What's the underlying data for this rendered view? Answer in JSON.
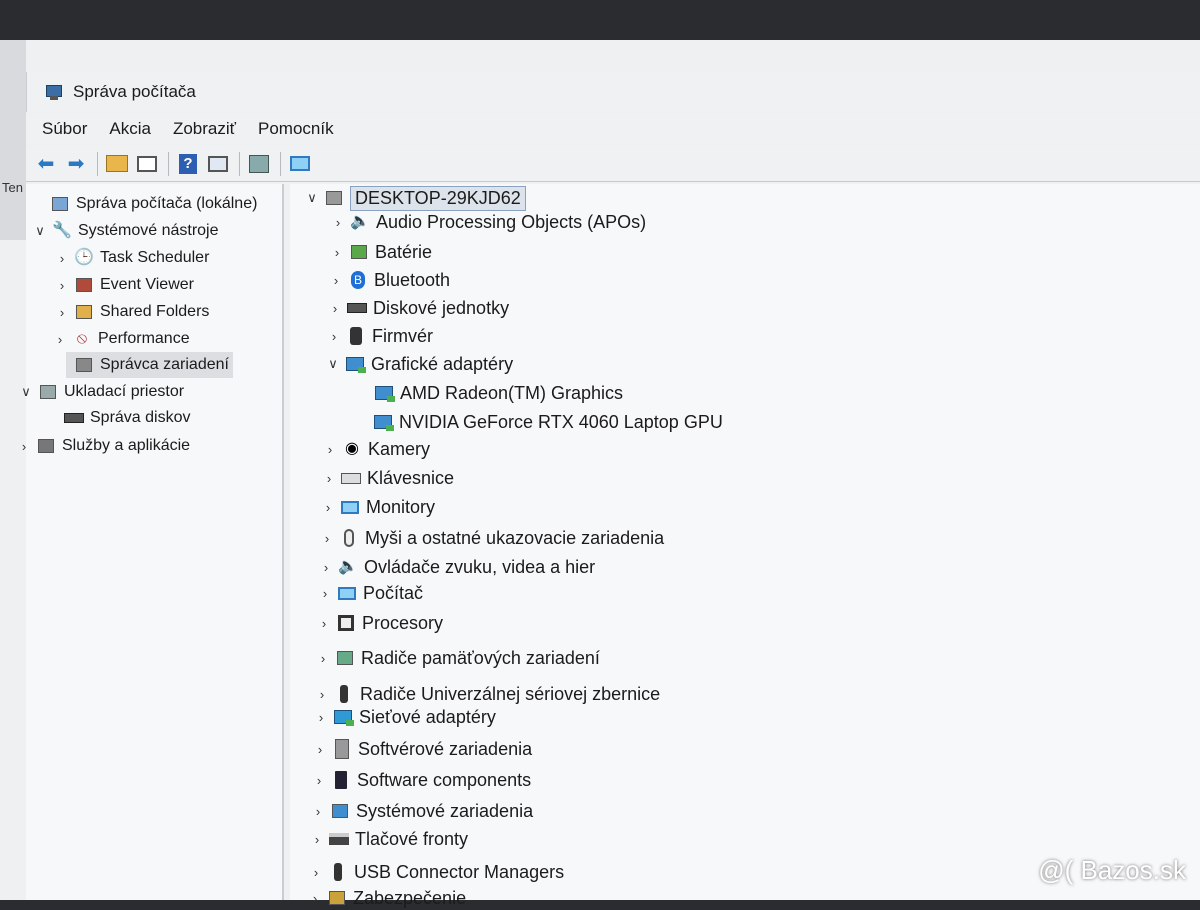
{
  "window": {
    "title": "Správa počítača"
  },
  "desktop": {
    "partial_text": "Ten"
  },
  "menu": [
    "Súbor",
    "Akcia",
    "Zobraziť",
    "Pomocník"
  ],
  "toolbar": {
    "buttons": [
      "back-arrow-icon",
      "forward-arrow-icon",
      "folder-up-icon",
      "properties-icon",
      "help-icon",
      "show-pane-icon",
      "export-icon",
      "monitor-icon"
    ]
  },
  "left_tree": [
    {
      "label": "Správa počítača (lokálne)",
      "icon": "computer-management-icon",
      "expander": ""
    },
    {
      "label": "Systémové nástroje",
      "icon": "tools-icon",
      "expander": "down"
    },
    {
      "label": "Task Scheduler",
      "icon": "clock-icon",
      "expander": "right"
    },
    {
      "label": "Event Viewer",
      "icon": "event-viewer-icon",
      "expander": "right"
    },
    {
      "label": "Shared Folders",
      "icon": "shared-folder-icon",
      "expander": "right"
    },
    {
      "label": "Performance",
      "icon": "performance-icon",
      "expander": "right"
    },
    {
      "label": "Správca zariadení",
      "icon": "device-manager-icon",
      "expander": "",
      "selected": true
    },
    {
      "label": "Ukladací priestor",
      "icon": "storage-icon",
      "expander": "down"
    },
    {
      "label": "Správa diskov",
      "icon": "disk-management-icon",
      "expander": ""
    },
    {
      "label": "Služby a aplikácie",
      "icon": "services-icon",
      "expander": "right"
    }
  ],
  "device_tree": {
    "root": "DESKTOP-29KJD62",
    "items": [
      {
        "label": "Audio Processing Objects (APOs)",
        "icon": "speaker-icon",
        "expander": "right"
      },
      {
        "label": "Batérie",
        "icon": "battery-icon",
        "expander": "right"
      },
      {
        "label": "Bluetooth",
        "icon": "bluetooth-icon",
        "expander": "right"
      },
      {
        "label": "Diskové jednotky",
        "icon": "disk-drive-icon",
        "expander": "right"
      },
      {
        "label": "Firmvér",
        "icon": "firmware-icon",
        "expander": "right"
      },
      {
        "label": "Grafické adaptéry",
        "icon": "display-adapter-icon",
        "expander": "down"
      },
      {
        "label": "AMD Radeon(TM) Graphics",
        "icon": "display-adapter-icon",
        "expander": "",
        "child": true
      },
      {
        "label": "NVIDIA GeForce RTX 4060 Laptop GPU",
        "icon": "display-adapter-icon",
        "expander": "",
        "child": true
      },
      {
        "label": "Kamery",
        "icon": "camera-icon",
        "expander": "right"
      },
      {
        "label": "Klávesnice",
        "icon": "keyboard-icon",
        "expander": "right"
      },
      {
        "label": "Monitory",
        "icon": "monitor-icon",
        "expander": "right"
      },
      {
        "label": "Myši a ostatné ukazovacie zariadenia",
        "icon": "mouse-icon",
        "expander": "right"
      },
      {
        "label": "Ovládače zvuku, videa a hier",
        "icon": "sound-icon",
        "expander": "right"
      },
      {
        "label": "Počítač",
        "icon": "computer-icon",
        "expander": "right"
      },
      {
        "label": "Procesory",
        "icon": "processor-icon",
        "expander": "right"
      },
      {
        "label": "Radiče pamäťových zariadení",
        "icon": "storage-controller-icon",
        "expander": "right"
      },
      {
        "label": "Radiče Univerzálnej sériovej zbernice",
        "icon": "usb-icon",
        "expander": "right"
      },
      {
        "label": "Sieťové adaptéry",
        "icon": "network-adapter-icon",
        "expander": "right"
      },
      {
        "label": "Softvérové zariadenia",
        "icon": "software-device-icon",
        "expander": "right"
      },
      {
        "label": "Software components",
        "icon": "software-component-icon",
        "expander": "right"
      },
      {
        "label": "Systémové zariadenia",
        "icon": "system-device-icon",
        "expander": "right"
      },
      {
        "label": "Tlačové fronty",
        "icon": "printer-icon",
        "expander": "right"
      },
      {
        "label": "USB Connector Managers",
        "icon": "usb-connector-icon",
        "expander": "right"
      },
      {
        "label": "Zabezpečenie",
        "icon": "security-icon",
        "expander": "right"
      }
    ]
  },
  "watermark": "@( Bazos.sk"
}
